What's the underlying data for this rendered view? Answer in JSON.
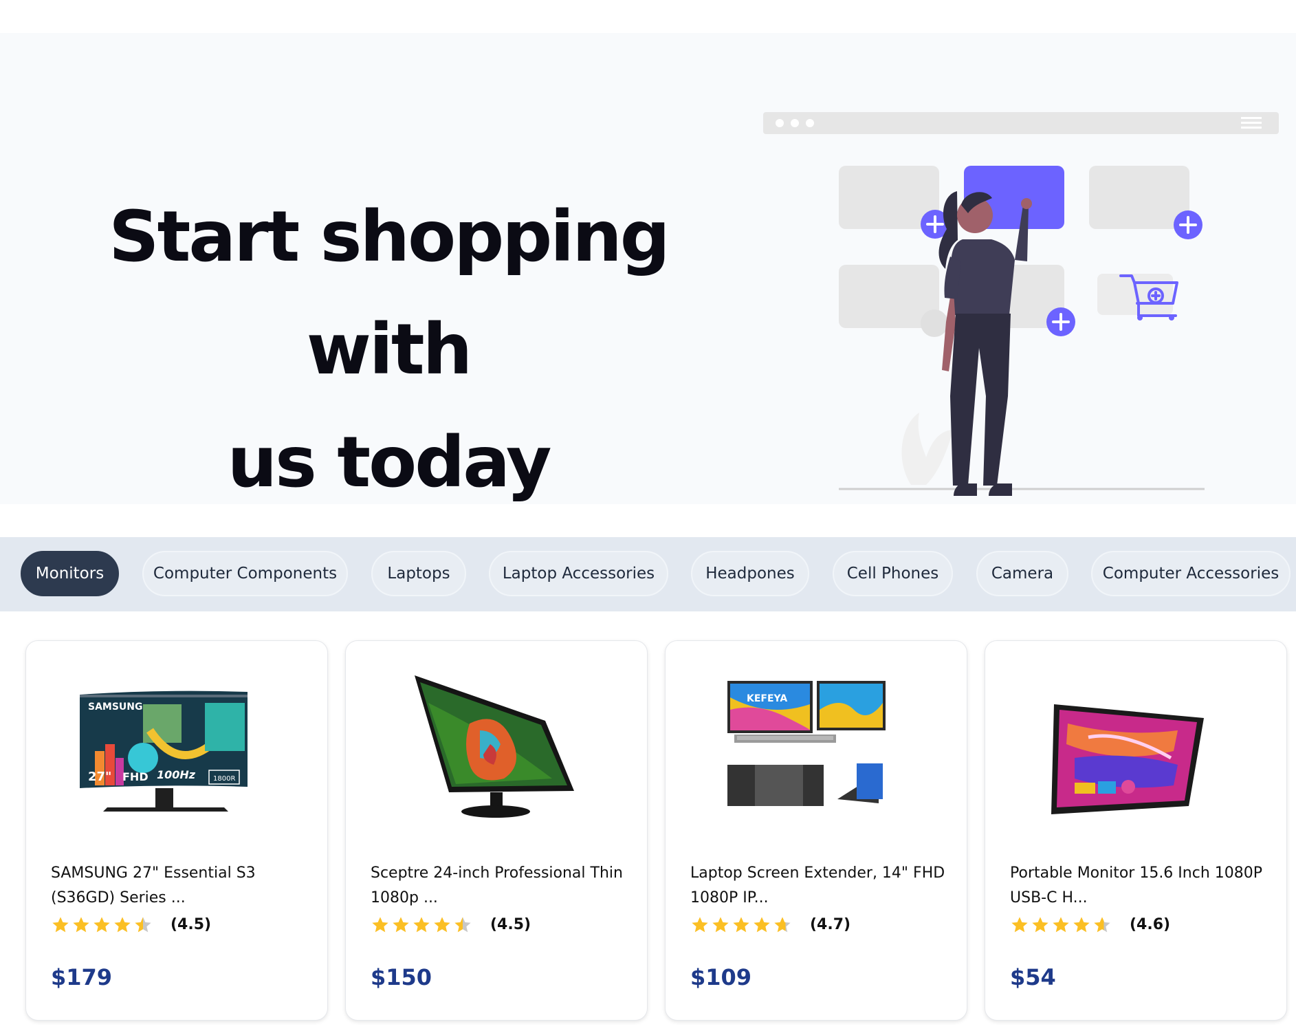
{
  "hero": {
    "line1": "Start shopping with",
    "line2": "us today"
  },
  "categories": [
    {
      "label": "Monitors",
      "active": true
    },
    {
      "label": "Computer Components",
      "active": false
    },
    {
      "label": "Laptops",
      "active": false
    },
    {
      "label": "Laptop Accessories",
      "active": false
    },
    {
      "label": "Headpones",
      "active": false
    },
    {
      "label": "Cell Phones",
      "active": false
    },
    {
      "label": "Camera",
      "active": false
    },
    {
      "label": "Computer Accessories",
      "active": false
    }
  ],
  "products": [
    {
      "title": "SAMSUNG 27\" Essential S3 (S36GD) Series ...",
      "rating": 4.5,
      "rating_label": "(4.5)",
      "price": "$179",
      "image_brand": "SAMSUNG",
      "image_badges": [
        "27\"",
        "FHD",
        "100Hz",
        "1800R"
      ]
    },
    {
      "title": "Sceptre 24-inch Professional Thin 1080p ...",
      "rating": 4.5,
      "rating_label": "(4.5)",
      "price": "$150"
    },
    {
      "title": "Laptop Screen Extender, 14\" FHD 1080P IP...",
      "rating": 4.7,
      "rating_label": "(4.7)",
      "price": "$109",
      "image_brand": "KEFEYA"
    },
    {
      "title": "Portable Monitor 15.6 Inch 1080P USB-C H...",
      "rating": 4.6,
      "rating_label": "(4.6)",
      "price": "$54"
    }
  ],
  "colors": {
    "accent": "#6c63ff",
    "price": "#1e3a8a",
    "star": "#fbbf24",
    "tab_active": "#2d3a4f",
    "tabs_bg": "#e2e8f0"
  }
}
